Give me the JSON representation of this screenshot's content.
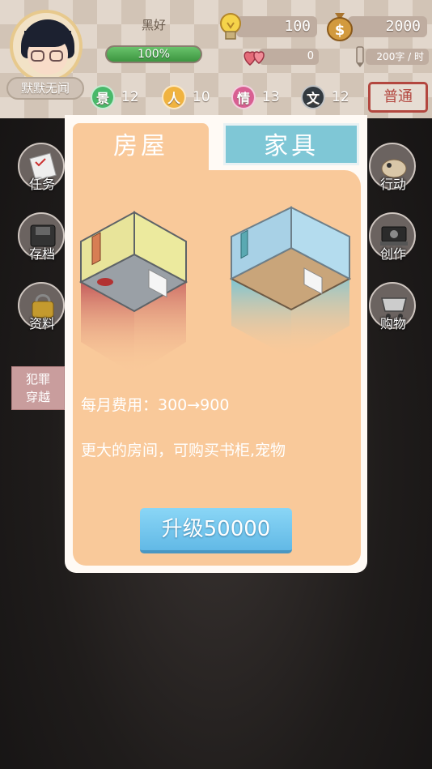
{
  "player": {
    "name": "默默无闻",
    "status_label": "黑好",
    "hp_percent_text": "100%",
    "hp_fraction": 1.0
  },
  "resources": {
    "idea": "100",
    "money": "2000",
    "love": "0",
    "speed": "200字 / 时"
  },
  "stats": [
    {
      "badge": "景",
      "value": "12",
      "color": "#49b96a"
    },
    {
      "badge": "人",
      "value": "10",
      "color": "#f0b340"
    },
    {
      "badge": "情",
      "value": "13",
      "color": "#d85f92"
    },
    {
      "badge": "文",
      "value": "12",
      "color": "#333a40"
    }
  ],
  "mode_button": "普通",
  "side_left": [
    {
      "label": "任务",
      "icon": "task-icon"
    },
    {
      "label": "存档",
      "icon": "save-icon"
    },
    {
      "label": "资料",
      "icon": "profile-icon"
    }
  ],
  "side_right": [
    {
      "label": "行动",
      "icon": "action-icon"
    },
    {
      "label": "创作",
      "icon": "create-icon"
    },
    {
      "label": "购物",
      "icon": "shop-icon"
    }
  ],
  "crime_button": [
    "犯罪",
    "穿越"
  ],
  "modal": {
    "tab_house": "房屋",
    "tab_furniture": "家具",
    "fee_text": "每月费用：300→900",
    "desc_text": "更大的房间，可购买书柜,宠物",
    "upgrade_label": "升级50000"
  },
  "colors": {
    "panel": "#f9c99a",
    "tab_inactive": "#7fc7d6",
    "upgrade": "#6ec3ee",
    "accent_red": "#b3473f"
  }
}
